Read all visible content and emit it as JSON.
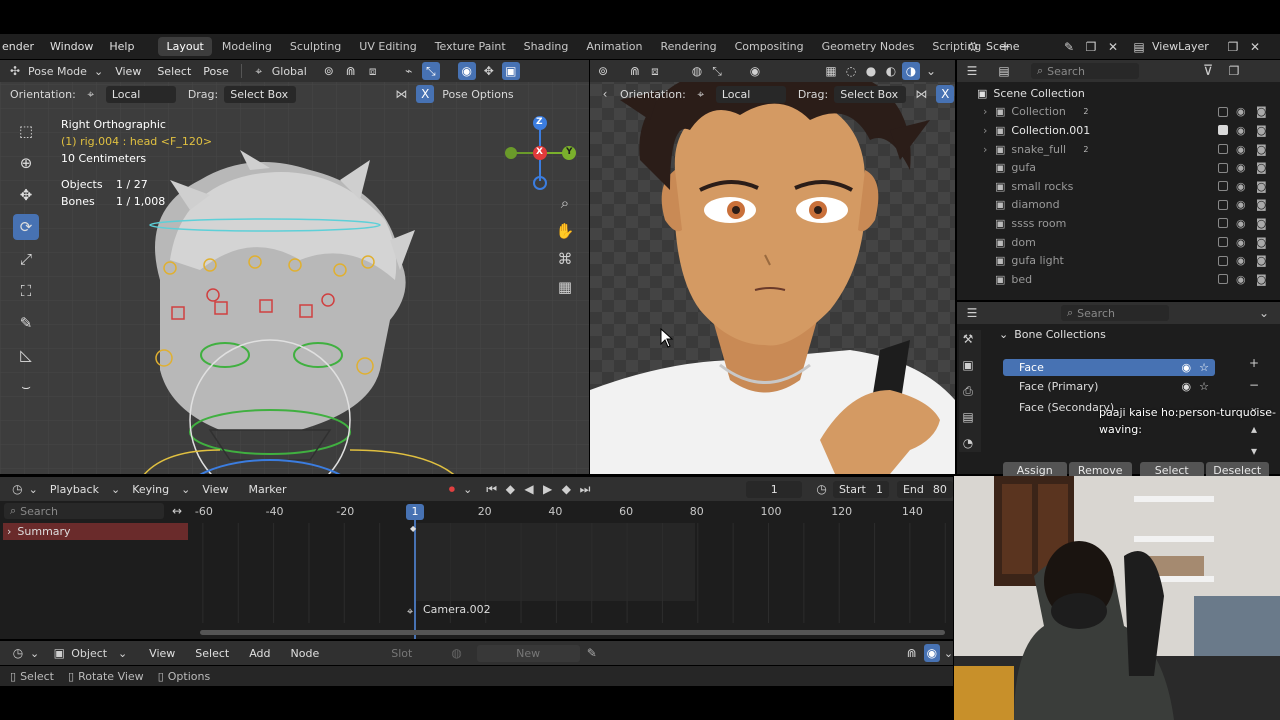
{
  "topbar": {
    "menus": [
      "ender",
      "Window",
      "Help"
    ],
    "workspace_tabs": [
      "Layout",
      "Modeling",
      "Sculpting",
      "UV Editing",
      "Texture Paint",
      "Shading",
      "Animation",
      "Rendering",
      "Compositing",
      "Geometry Nodes",
      "Scripting"
    ],
    "active_tab": "Layout",
    "add_tab": "+",
    "scene_label": "Scene",
    "viewlayer_label": "ViewLayer"
  },
  "viewport_left": {
    "mode": "Pose Mode",
    "menus": [
      "View",
      "Select",
      "Pose"
    ],
    "transform_orientation": "Global",
    "orientation_label": "Orientation:",
    "orientation_value": "Local",
    "drag_label": "Drag:",
    "drag_value": "Select Box",
    "pose_options": "Pose Options",
    "overlay_title": "Right Orthographic",
    "overlay_active": "(1) rig.004 : head <F_120>",
    "overlay_scale": "10 Centimeters",
    "objects_label": "Objects",
    "objects_value": "1 / 27",
    "bones_label": "Bones",
    "bones_value": "1 / 1,008",
    "gizmo": {
      "z": "Z",
      "x": "X",
      "y": "Y"
    }
  },
  "viewport_right": {
    "orientation_label": "Orientation:",
    "orientation_value": "Local",
    "drag_label": "Drag:",
    "drag_value": "Select Box"
  },
  "outliner": {
    "search_placeholder": "Search",
    "root": "Scene Collection",
    "items": [
      {
        "name": "Collection",
        "badge": "2",
        "checked": false,
        "bright": false
      },
      {
        "name": "Collection.001",
        "badge": "",
        "checked": true,
        "bright": true
      },
      {
        "name": "snake_full",
        "badge": "2",
        "checked": false,
        "bright": false
      },
      {
        "name": "gufa",
        "badge": "",
        "checked": false,
        "bright": false
      },
      {
        "name": "small rocks",
        "badge": "",
        "checked": false,
        "bright": false
      },
      {
        "name": "diamond",
        "badge": "",
        "checked": false,
        "bright": false
      },
      {
        "name": "ssss room",
        "badge": "",
        "checked": false,
        "bright": false
      },
      {
        "name": "dom",
        "badge": "",
        "checked": false,
        "bright": false
      },
      {
        "name": "gufa light",
        "badge": "",
        "checked": false,
        "bright": false
      },
      {
        "name": "bed",
        "badge": "",
        "checked": false,
        "bright": false
      }
    ]
  },
  "properties": {
    "search_placeholder": "Search",
    "section": "Bone Collections",
    "bone_collections": [
      "Face",
      "Face (Primary)",
      "Face (Secondary)"
    ],
    "buttons": [
      "Assign",
      "Remove",
      "Select",
      "Deselect"
    ],
    "chat_user": "paaji kaise ho:person-turquoise-",
    "chat_line2": "waving:"
  },
  "timeline": {
    "menus": [
      "Playback",
      "Keying",
      "View",
      "Marker"
    ],
    "current_frame": "1",
    "start_label": "Start",
    "start_value": "1",
    "end_label": "End",
    "end_value": "80",
    "search_placeholder": "Search",
    "summary": "Summary",
    "ruler": [
      "-60",
      "-40",
      "-20",
      "1",
      "20",
      "40",
      "60",
      "80",
      "100",
      "120",
      "140"
    ],
    "marker": "Camera.002"
  },
  "node_editor": {
    "type": "Object",
    "menus": [
      "View",
      "Select",
      "Add",
      "Node"
    ],
    "slot": "Slot",
    "new_label": "New"
  },
  "statusbar": {
    "items": [
      "Select",
      "Rotate View",
      "Options"
    ]
  },
  "colors": {
    "accent": "#4772b3",
    "header": "#303030",
    "panel": "#1d1d1d",
    "overlay_yellow": "#e0c040",
    "summary_bg": "#6a2b2b"
  }
}
